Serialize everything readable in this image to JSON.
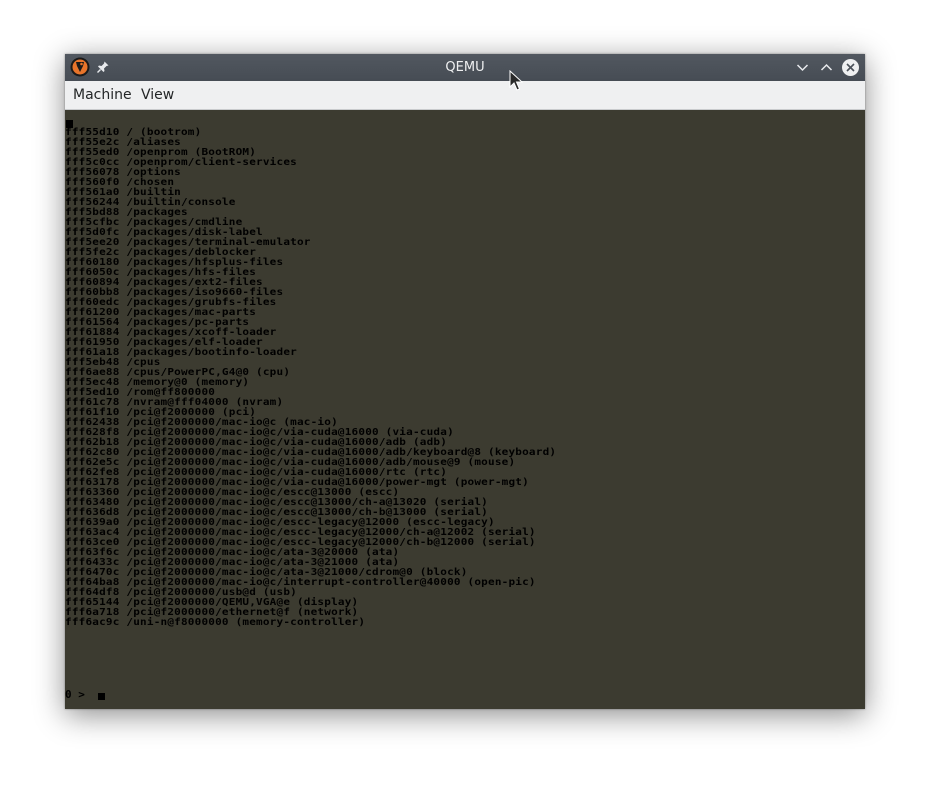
{
  "window": {
    "title": "QEMU",
    "icons": {
      "app": "qemu-icon",
      "pin": "pin-icon",
      "minimize": "chevron-down-icon",
      "maximize": "chevron-up-icon",
      "close": "close-icon"
    }
  },
  "menu": {
    "machine": "Machine",
    "view": "View"
  },
  "console": {
    "lines": [
      "fff55d10 / (bootrom)",
      "fff55e2c /aliases",
      "fff55ed0 /openprom (BootROM)",
      "fff5c0cc /openprom/client-services",
      "fff56078 /options",
      "fff560f0 /chosen",
      "fff561a0 /builtin",
      "fff56244 /builtin/console",
      "fff5bd88 /packages",
      "fff5cfbc /packages/cmdline",
      "fff5d0fc /packages/disk-label",
      "fff5ee20 /packages/terminal-emulator",
      "fff5fe2c /packages/deblocker",
      "fff60180 /packages/hfsplus-files",
      "fff6050c /packages/hfs-files",
      "fff60894 /packages/ext2-files",
      "fff60bb8 /packages/iso9660-files",
      "fff60edc /packages/grubfs-files",
      "fff61200 /packages/mac-parts",
      "fff61564 /packages/pc-parts",
      "fff61884 /packages/xcoff-loader",
      "fff61950 /packages/elf-loader",
      "fff61a18 /packages/bootinfo-loader",
      "fff5eb48 /cpus",
      "fff6ae88 /cpus/PowerPC,G4@0 (cpu)",
      "fff5ec48 /memory@0 (memory)",
      "fff5ed10 /rom@ff800000",
      "fff61c78 /nvram@fff04000 (nvram)",
      "fff61f10 /pci@f2000000 (pci)",
      "fff62438 /pci@f2000000/mac-io@c (mac-io)",
      "fff628f8 /pci@f2000000/mac-io@c/via-cuda@16000 (via-cuda)",
      "fff62b18 /pci@f2000000/mac-io@c/via-cuda@16000/adb (adb)",
      "fff62c80 /pci@f2000000/mac-io@c/via-cuda@16000/adb/keyboard@8 (keyboard)",
      "fff62e5c /pci@f2000000/mac-io@c/via-cuda@16000/adb/mouse@9 (mouse)",
      "fff62fe8 /pci@f2000000/mac-io@c/via-cuda@16000/rtc (rtc)",
      "fff63178 /pci@f2000000/mac-io@c/via-cuda@16000/power-mgt (power-mgt)",
      "fff63360 /pci@f2000000/mac-io@c/escc@13000 (escc)",
      "fff63480 /pci@f2000000/mac-io@c/escc@13000/ch-a@13020 (serial)",
      "fff636d8 /pci@f2000000/mac-io@c/escc@13000/ch-b@13000 (serial)",
      "fff639a0 /pci@f2000000/mac-io@c/escc-legacy@12000 (escc-legacy)",
      "fff63ac4 /pci@f2000000/mac-io@c/escc-legacy@12000/ch-a@12002 (serial)",
      "fff63ce0 /pci@f2000000/mac-io@c/escc-legacy@12000/ch-b@12000 (serial)",
      "fff63f6c /pci@f2000000/mac-io@c/ata-3@20000 (ata)",
      "fff6433c /pci@f2000000/mac-io@c/ata-3@21000 (ata)",
      "fff6470c /pci@f2000000/mac-io@c/ata-3@21000/cdrom@0 (block)",
      "fff64ba8 /pci@f2000000/mac-io@c/interrupt-controller@40000 (open-pic)",
      "fff64df8 /pci@f2000000/usb@d (usb)",
      "fff65144 /pci@f2000000/QEMU,VGA@e (display)",
      "fff6a718 /pci@f2000000/ethernet@f (network)",
      "fff6ac9c /uni-n@f8000000 (memory-controller)"
    ],
    "prompt": "0 > "
  },
  "colors": {
    "console_bg": "#3c3b30",
    "console_text": "#000000",
    "titlebar": "#4c525a",
    "menubar": "#eff0f1"
  }
}
